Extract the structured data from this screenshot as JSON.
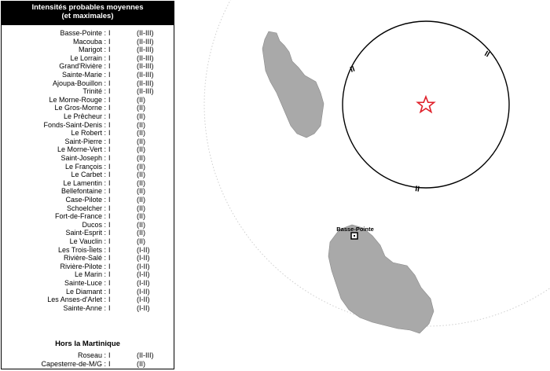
{
  "legend": {
    "title_line1": "Intensités probables moyennes",
    "title_line2": "(et maximales)",
    "rows": [
      {
        "place": "Basse-Pointe :",
        "value": "I",
        "range": "(II-III)"
      },
      {
        "place": "Macouba :",
        "value": "I",
        "range": "(II-III)"
      },
      {
        "place": "Marigot :",
        "value": "I",
        "range": "(II-III)"
      },
      {
        "place": "Le Lorrain :",
        "value": "I",
        "range": "(II-III)"
      },
      {
        "place": "Grand'Rivière :",
        "value": "I",
        "range": "(II-III)"
      },
      {
        "place": "Sainte-Marie :",
        "value": "I",
        "range": "(II-III)"
      },
      {
        "place": "Ajoupa-Bouillon :",
        "value": "I",
        "range": "(II-III)"
      },
      {
        "place": "Trinité :",
        "value": "I",
        "range": "(II-III)"
      },
      {
        "place": "Le Morne-Rouge :",
        "value": "I",
        "range": "(II)"
      },
      {
        "place": "Le Gros-Morne :",
        "value": "I",
        "range": "(II)"
      },
      {
        "place": "Le Prêcheur :",
        "value": "I",
        "range": "(II)"
      },
      {
        "place": "Fonds-Saint-Denis :",
        "value": "I",
        "range": "(II)"
      },
      {
        "place": "Le Robert :",
        "value": "I",
        "range": "(II)"
      },
      {
        "place": "Saint-Pierre :",
        "value": "I",
        "range": "(II)"
      },
      {
        "place": "Le Morne-Vert :",
        "value": "I",
        "range": "(II)"
      },
      {
        "place": "Saint-Joseph :",
        "value": "I",
        "range": "(II)"
      },
      {
        "place": "Le François :",
        "value": "I",
        "range": "(II)"
      },
      {
        "place": "Le Carbet :",
        "value": "I",
        "range": "(II)"
      },
      {
        "place": "Le Lamentin :",
        "value": "I",
        "range": "(II)"
      },
      {
        "place": "Bellefontaine :",
        "value": "I",
        "range": "(II)"
      },
      {
        "place": "Case-Pilote :",
        "value": "I",
        "range": "(II)"
      },
      {
        "place": "Schoelcher :",
        "value": "I",
        "range": "(II)"
      },
      {
        "place": "Fort-de-France :",
        "value": "I",
        "range": "(II)"
      },
      {
        "place": "Ducos :",
        "value": "I",
        "range": "(II)"
      },
      {
        "place": "Saint-Esprit :",
        "value": "I",
        "range": "(II)"
      },
      {
        "place": "Le Vauclin :",
        "value": "I",
        "range": "(II)"
      },
      {
        "place": "Les Trois-Îlets :",
        "value": "I",
        "range": "(I-II)"
      },
      {
        "place": "Rivière-Salé :",
        "value": "I",
        "range": "(I-II)"
      },
      {
        "place": "Rivière-Pilote :",
        "value": "I",
        "range": "(I-II)"
      },
      {
        "place": "Le Marin :",
        "value": "I",
        "range": "(I-II)"
      },
      {
        "place": "Sainte-Luce :",
        "value": "I",
        "range": "(I-II)"
      },
      {
        "place": "Le Diamant :",
        "value": "I",
        "range": "(I-II)"
      },
      {
        "place": "Les Anses-d'Arlet :",
        "value": "I",
        "range": "(I-II)"
      },
      {
        "place": "Sainte-Anne :",
        "value": "I",
        "range": "(I-II)"
      }
    ],
    "hors_title": "Hors la Martinique",
    "hors_rows": [
      {
        "place": "Roseau :",
        "value": "I",
        "range": "(II-III)"
      },
      {
        "place": "Capesterre-de-M/G :",
        "value": "I",
        "range": "(II)"
      }
    ]
  },
  "map": {
    "town_label": "Basse-Pointe",
    "isoseismal_labels": [
      "II",
      "II",
      "II"
    ],
    "epicenter_color": "#e0202a",
    "isoseismal_color": "#000000",
    "outer_ring_color": "#cfcfcf",
    "land_color": "#a9a9a9"
  }
}
